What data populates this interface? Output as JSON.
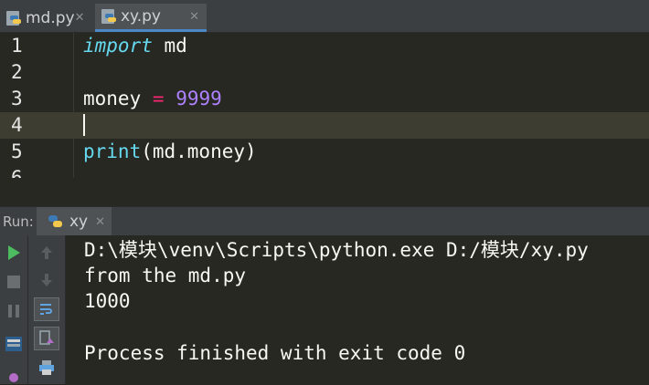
{
  "tabs": [
    {
      "label": "md.py",
      "icon": "python-file-icon",
      "active": false
    },
    {
      "label": "xy.py",
      "icon": "python-file-icon",
      "active": true
    }
  ],
  "editor": {
    "line_numbers": [
      "1",
      "2",
      "3",
      "4",
      "5",
      "6"
    ],
    "line1_keyword": "import",
    "line1_rest": " md",
    "line3_name": "money",
    "line3_op": "=",
    "line3_value": "9999",
    "line5_fn": "print",
    "line5_rest": "(md.money)",
    "current_line": 4
  },
  "run": {
    "label": "Run:",
    "tab_label": "xy",
    "tab_icon": "python-file-icon"
  },
  "console": {
    "lines": [
      "D:\\模块\\venv\\Scripts\\python.exe D:/模块/xy.py",
      "from the md.py",
      "1000",
      "",
      "Process finished with exit code 0"
    ]
  },
  "colors": {
    "background": "#272822",
    "keyword": "#66d9ef",
    "operator": "#f92672",
    "number": "#ae81ff",
    "run_green": "#4dbb5f",
    "accent": "#4a88c7"
  }
}
